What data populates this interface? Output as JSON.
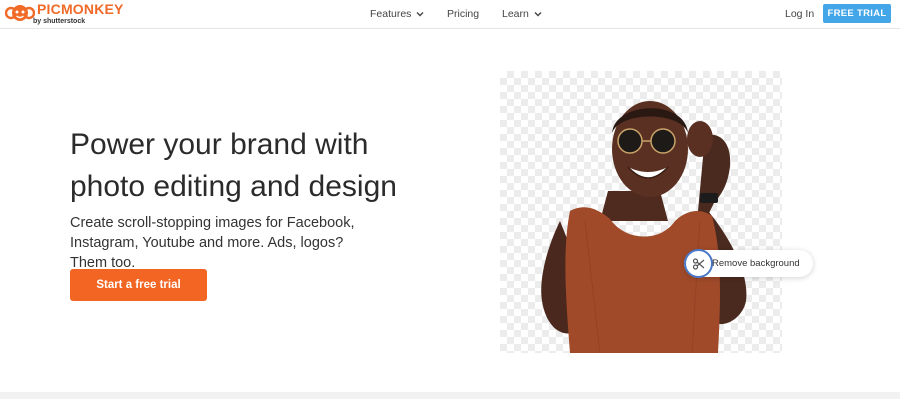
{
  "brand": {
    "name": "PICMONKEY",
    "byline": "by shutterstock",
    "accent": "#f06a28"
  },
  "nav": {
    "features": "Features",
    "pricing": "Pricing",
    "learn": "Learn"
  },
  "account": {
    "login": "Log In",
    "trial": "FREE TRIAL",
    "trial_color": "#43a6e8"
  },
  "hero": {
    "headline": "Power your brand with photo editing and design",
    "subtext": "Create scroll-stopping images for Facebook, Instagram, Youtube and more. Ads, logos? Them too.",
    "cta": "Start a free trial",
    "cta_color": "#f26522"
  },
  "feature_chip": {
    "label": "Remove background",
    "icon": "scissors-icon"
  }
}
